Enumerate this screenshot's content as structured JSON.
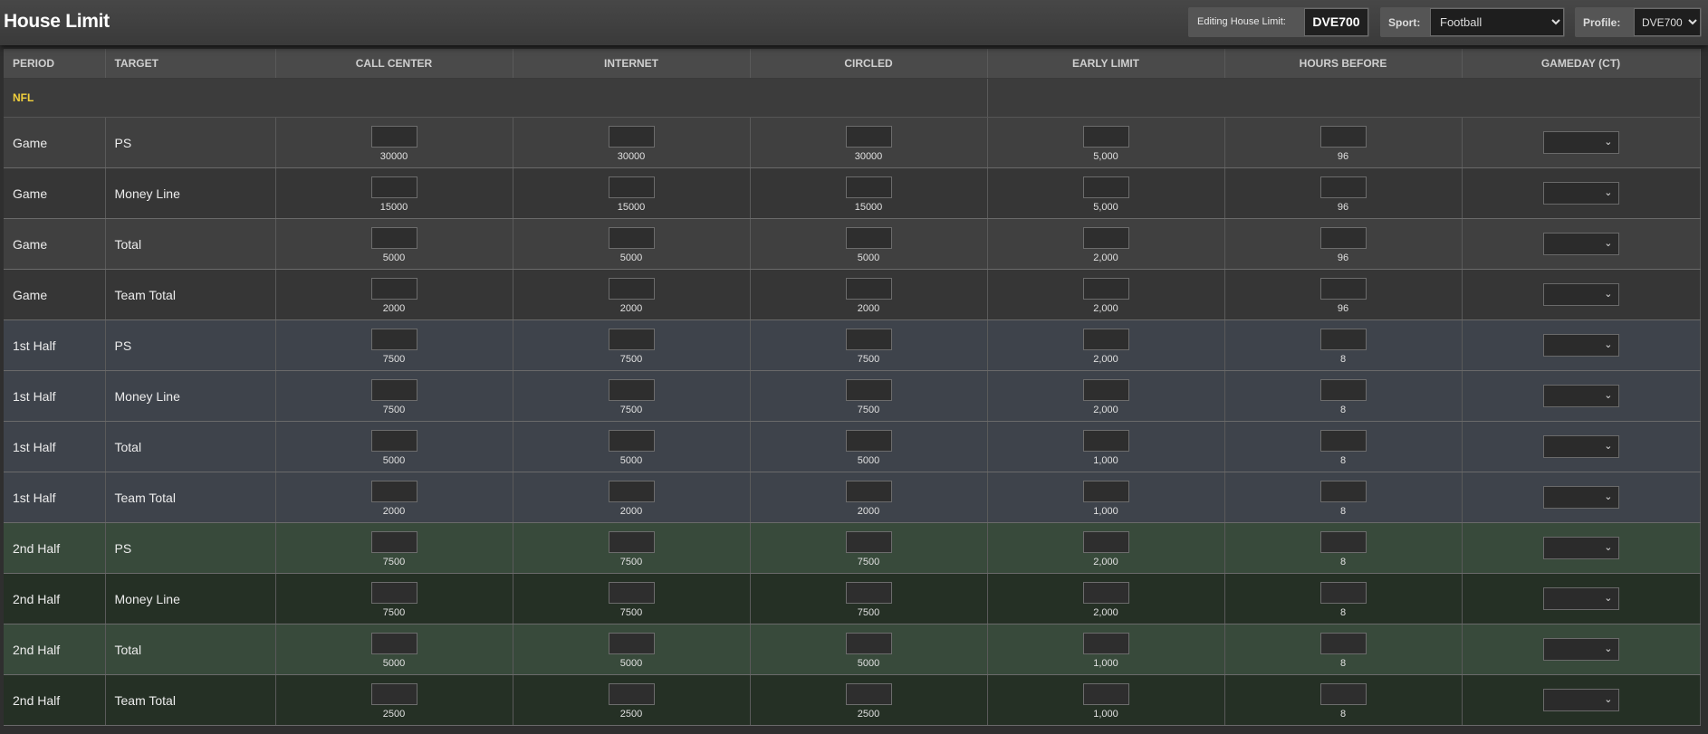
{
  "header": {
    "title": "House Limit",
    "editing_label": "Editing House Limit:",
    "editing_value": "DVE700",
    "sport_label": "Sport:",
    "sport_selected": "Football",
    "profile_label": "Profile:",
    "profile_selected": "DVE700"
  },
  "columns": [
    "PERIOD",
    "TARGET",
    "CALL CENTER",
    "INTERNET",
    "CIRCLED",
    "EARLY LIMIT",
    "HOURS BEFORE",
    "GAMEDAY (CT)"
  ],
  "sport_section": "NFL",
  "rows": [
    {
      "period": "Game",
      "target": "PS",
      "call_center": "30000",
      "internet": "30000",
      "circled": "30000",
      "early_limit": "5,000",
      "hours_before": "96"
    },
    {
      "period": "Game",
      "target": "Money Line",
      "call_center": "15000",
      "internet": "15000",
      "circled": "15000",
      "early_limit": "5,000",
      "hours_before": "96"
    },
    {
      "period": "Game",
      "target": "Total",
      "call_center": "5000",
      "internet": "5000",
      "circled": "5000",
      "early_limit": "2,000",
      "hours_before": "96"
    },
    {
      "period": "Game",
      "target": "Team Total",
      "call_center": "2000",
      "internet": "2000",
      "circled": "2000",
      "early_limit": "2,000",
      "hours_before": "96"
    },
    {
      "period": "1st Half",
      "target": "PS",
      "call_center": "7500",
      "internet": "7500",
      "circled": "7500",
      "early_limit": "2,000",
      "hours_before": "8"
    },
    {
      "period": "1st Half",
      "target": "Money Line",
      "call_center": "7500",
      "internet": "7500",
      "circled": "7500",
      "early_limit": "2,000",
      "hours_before": "8"
    },
    {
      "period": "1st Half",
      "target": "Total",
      "call_center": "5000",
      "internet": "5000",
      "circled": "5000",
      "early_limit": "1,000",
      "hours_before": "8"
    },
    {
      "period": "1st Half",
      "target": "Team Total",
      "call_center": "2000",
      "internet": "2000",
      "circled": "2000",
      "early_limit": "1,000",
      "hours_before": "8"
    },
    {
      "period": "2nd Half",
      "target": "PS",
      "call_center": "7500",
      "internet": "7500",
      "circled": "7500",
      "early_limit": "2,000",
      "hours_before": "8"
    },
    {
      "period": "2nd Half",
      "target": "Money Line",
      "call_center": "7500",
      "internet": "7500",
      "circled": "7500",
      "early_limit": "2,000",
      "hours_before": "8"
    },
    {
      "period": "2nd Half",
      "target": "Total",
      "call_center": "5000",
      "internet": "5000",
      "circled": "5000",
      "early_limit": "1,000",
      "hours_before": "8"
    },
    {
      "period": "2nd Half",
      "target": "Team Total",
      "call_center": "2500",
      "internet": "2500",
      "circled": "2500",
      "early_limit": "1,000",
      "hours_before": "8"
    }
  ],
  "icons": {
    "dropdown": "chevron-down-icon"
  },
  "colors": {
    "sport_section": "#f2d03c",
    "header_bg": "#4a4a4a",
    "first_half_bg": "#3e434b",
    "second_half_bg": "#384a3b"
  }
}
